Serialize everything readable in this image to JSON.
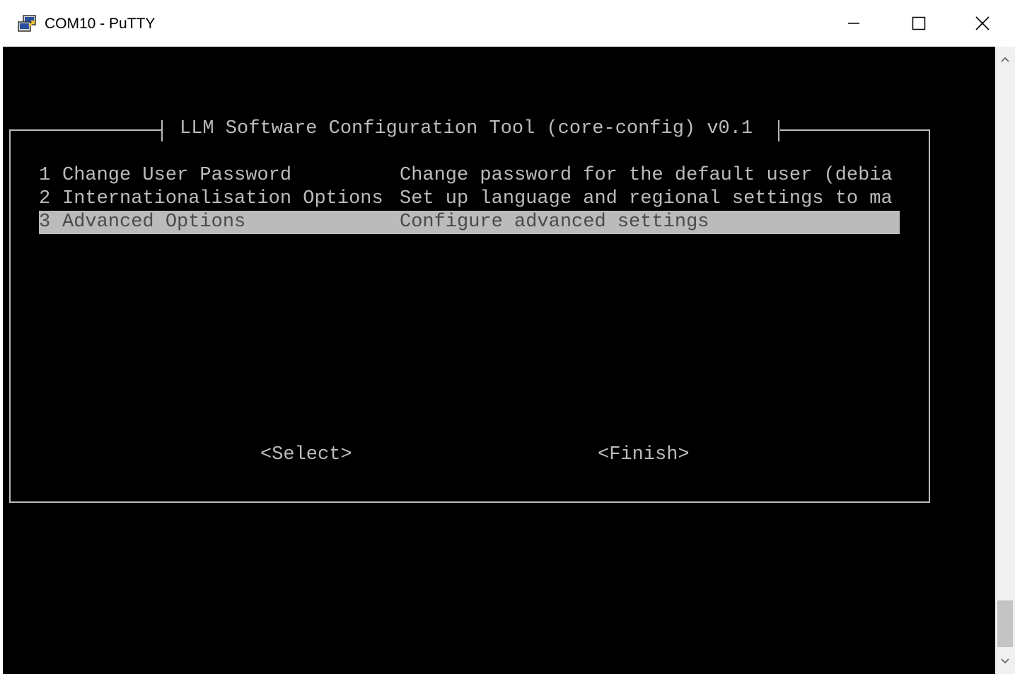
{
  "window": {
    "title": "COM10 - PuTTY",
    "app_icon": "putty-computers-icon"
  },
  "caption_buttons": {
    "minimize_icon": "minimize-icon",
    "maximize_icon": "maximize-icon",
    "close_icon": "close-icon"
  },
  "dialog": {
    "title": "LLM Software Configuration Tool (core-config) v0.1",
    "menu_items": [
      {
        "number": "1",
        "name": "Change User Password",
        "description": "Change password for the default user (debia",
        "selected": false
      },
      {
        "number": "2",
        "name": "Internationalisation Options",
        "description": "Set up language and regional settings to ma",
        "selected": false
      },
      {
        "number": "3",
        "name": "Advanced Options",
        "description": "Configure advanced settings",
        "selected": true
      }
    ],
    "select_label": "<Select>",
    "finish_label": "<Finish>"
  },
  "scrollbar": {
    "up_icon": "chevron-up-icon",
    "down_icon": "chevron-down-icon"
  },
  "colors": {
    "terminal_bg": "#000000",
    "terminal_fg": "#bbbbbb",
    "highlight_bg": "#bbbbbb",
    "highlight_fg": "#4a4a4a"
  }
}
